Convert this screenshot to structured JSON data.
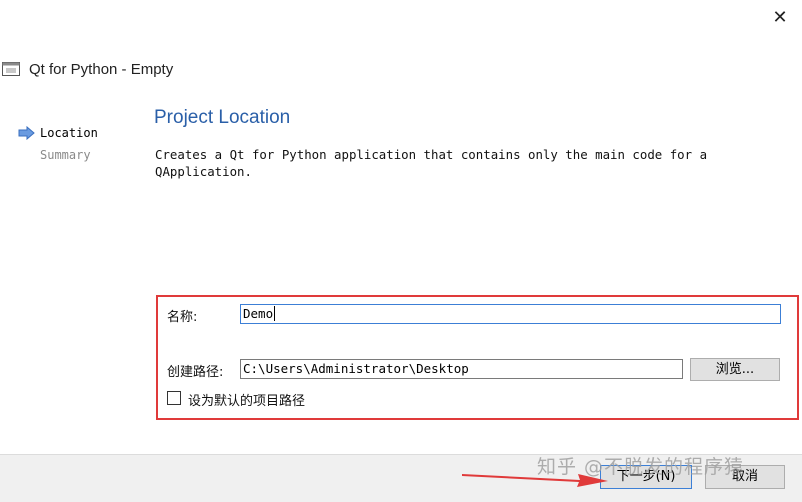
{
  "window": {
    "title": "Qt for Python - Empty",
    "close_label": "✕"
  },
  "steps": {
    "current": "Location",
    "other": "Summary"
  },
  "page": {
    "title": "Project Location",
    "description": "Creates a Qt for Python application that contains only the main code for a QApplication."
  },
  "form": {
    "name_label": "名称:",
    "name_value": "Demo",
    "path_label": "创建路径:",
    "path_value": "C:\\Users\\Administrator\\Desktop",
    "browse_label": "浏览...",
    "default_path_label": "设为默认的项目路径",
    "default_path_checked": false
  },
  "footer": {
    "next_label": "下一步(N)",
    "cancel_label": "取消"
  },
  "annotation": {
    "watermark": "知乎 @不脱发的程序猿",
    "highlight_color": "#e03a3a"
  },
  "colors": {
    "accent": "#2a5fa8",
    "focus": "#3c7fd6"
  }
}
